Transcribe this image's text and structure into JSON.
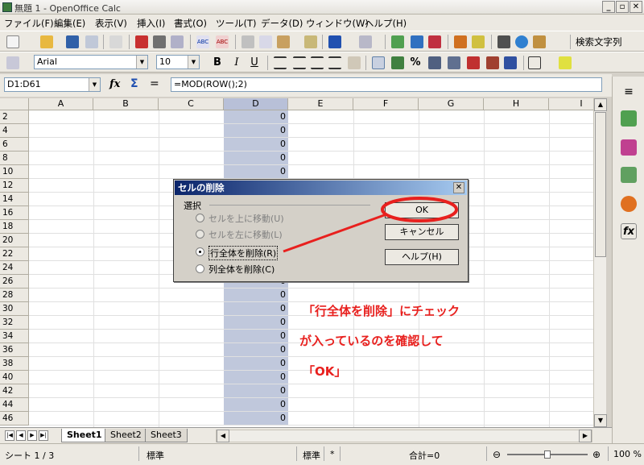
{
  "window": {
    "title": "無題 1 - OpenOffice Calc"
  },
  "menu": [
    "ファイル(F)",
    "編集(E)",
    "表示(V)",
    "挿入(I)",
    "書式(O)",
    "ツール(T)",
    "データ(D)",
    "ウィンドウ(W)",
    "ヘルプ(H)"
  ],
  "toolbar": {
    "search_label": "検索文字列"
  },
  "format": {
    "font": "Arial",
    "size": "10",
    "bold": "B",
    "italic": "I",
    "underline": "U",
    "percent": "%"
  },
  "formula": {
    "namebox": "D1:D61",
    "content": "=MOD(ROW();2)"
  },
  "grid": {
    "columns": [
      "A",
      "B",
      "C",
      "D",
      "E",
      "F",
      "G",
      "H",
      "I"
    ],
    "rows": [
      "2",
      "4",
      "6",
      "8",
      "10",
      "12",
      "14",
      "16",
      "18",
      "20",
      "22",
      "24",
      "26",
      "28",
      "30",
      "32",
      "34",
      "36",
      "38",
      "40",
      "42",
      "44",
      "46"
    ],
    "cell_value": "0"
  },
  "dialog": {
    "title": "セルの削除",
    "group_label": "選択",
    "options": [
      "セルを上に移動(U)",
      "セルを左に移動(L)",
      "行全体を削除(R)",
      "列全体を削除(C)"
    ],
    "selected": "行全体を削除(R)",
    "ok": "OK",
    "cancel": "キャンセル",
    "help": "ヘルプ(H)"
  },
  "annotation": {
    "line1": "「行全体を削除」にチェック",
    "line2": "が入っているのを確認して",
    "line3": "「OK」"
  },
  "sheets": [
    "Sheet1",
    "Sheet2",
    "Sheet3"
  ],
  "status": {
    "sheet": "シート 1 / 3",
    "style": "標準",
    "mode": "標準",
    "modified": "*",
    "sum": "合計=0",
    "zoom": "100 %"
  },
  "colors": {
    "highlight": "#c0c8dc",
    "annotation": "#e8201e",
    "dialog_title": "#0a246a"
  }
}
